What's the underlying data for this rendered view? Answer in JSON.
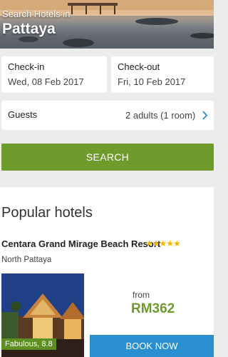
{
  "hero": {
    "subtitle": "Search Hotels in",
    "city": "Pattaya"
  },
  "checkin": {
    "label": "Check-in",
    "value": "Wed, 08 Feb 2017"
  },
  "checkout": {
    "label": "Check-out",
    "value": "Fri, 10 Feb 2017"
  },
  "guests": {
    "label": "Guests",
    "value": "2 adults (1 room)",
    "icon": "chevron-right-icon"
  },
  "search": {
    "label": "SEARCH"
  },
  "popular": {
    "title": "Popular hotels",
    "hotel": {
      "name": "Centara Grand Mirage Beach Resort",
      "stars": "★★★★★",
      "star_count": 5,
      "area": "North Pattaya",
      "rating": "Fabulous, 8.8",
      "from_label": "from",
      "price": "RM362",
      "book_label": "BOOK NOW"
    }
  },
  "colors": {
    "primary_green": "#6f9b2c",
    "book_blue": "#2a8fd1",
    "star": "#f5b400",
    "chevron": "#2a8fd1"
  }
}
